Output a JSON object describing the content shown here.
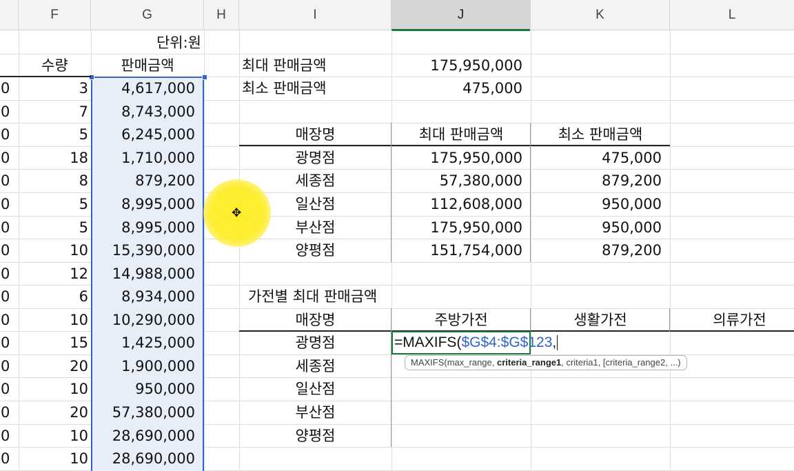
{
  "columns": [
    "F",
    "G",
    "H",
    "I",
    "J",
    "K",
    "L"
  ],
  "selected_column": "J",
  "unit_label": "단위:원",
  "headers": {
    "qty": "수량",
    "sales": "판매금액"
  },
  "edge_digit": "0",
  "rows": [
    {
      "qty": "3",
      "sales": "4,617,000"
    },
    {
      "qty": "7",
      "sales": "8,743,000"
    },
    {
      "qty": "5",
      "sales": "6,245,000"
    },
    {
      "qty": "18",
      "sales": "1,710,000"
    },
    {
      "qty": "8",
      "sales": "879,200"
    },
    {
      "qty": "5",
      "sales": "8,995,000"
    },
    {
      "qty": "5",
      "sales": "8,995,000"
    },
    {
      "qty": "10",
      "sales": "15,390,000"
    },
    {
      "qty": "12",
      "sales": "14,988,000"
    },
    {
      "qty": "6",
      "sales": "8,934,000"
    },
    {
      "qty": "10",
      "sales": "10,290,000"
    },
    {
      "qty": "15",
      "sales": "1,425,000"
    },
    {
      "qty": "20",
      "sales": "1,900,000"
    },
    {
      "qty": "10",
      "sales": "950,000"
    },
    {
      "qty": "20",
      "sales": "57,380,000"
    },
    {
      "qty": "10",
      "sales": "28,690,000"
    },
    {
      "qty": "10",
      "sales": "28,690,000"
    }
  ],
  "summary": [
    {
      "label": "최대 판매금액",
      "value": "175,950,000"
    },
    {
      "label": "최소 판매금액",
      "value": "475,000"
    }
  ],
  "store_table": {
    "headers": [
      "매장명",
      "최대 판매금액",
      "최소 판매금액"
    ],
    "rows": [
      {
        "store": "광명점",
        "max": "175,950,000",
        "min": "475,000"
      },
      {
        "store": "세종점",
        "max": "57,380,000",
        "min": "879,200"
      },
      {
        "store": "일산점",
        "max": "112,608,000",
        "min": "950,000"
      },
      {
        "store": "부산점",
        "max": "175,950,000",
        "min": "950,000"
      },
      {
        "store": "양평점",
        "max": "151,754,000",
        "min": "879,200"
      }
    ]
  },
  "appliance_section": {
    "title": "가전별 최대 판매금액",
    "headers": [
      "매장명",
      "주방가전",
      "생활가전",
      "의류가전"
    ],
    "stores": [
      "광명점",
      "세종점",
      "일산점",
      "부산점",
      "양평점"
    ]
  },
  "formula": {
    "prefix": "=MAXIFS(",
    "ref": "$G$4:$G$123",
    "suffix": ","
  },
  "tooltip": {
    "start": "MAXIFS(max_range, ",
    "bold": "criteria_range1",
    "end": ", criteria1, [criteria_range2, ...)"
  },
  "colors": {
    "selection_blue": "#2f64c8",
    "active_green": "#1a7a3a",
    "highlight_yellow": "#ffee28"
  }
}
